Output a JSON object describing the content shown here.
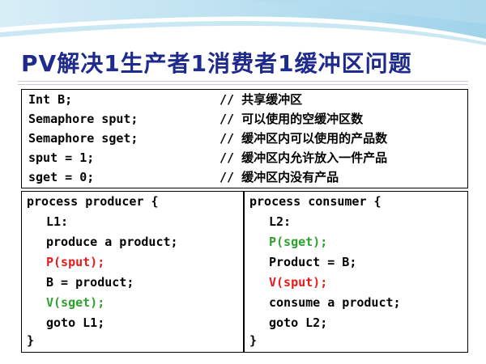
{
  "slide": {
    "title": "PV解决1生产者1消费者1缓冲区问题",
    "colors": {
      "title": "#1e2a8c",
      "red": "#e8191a",
      "green": "#2ea02e",
      "swoosh": "#bfe3f2"
    }
  },
  "declarations": [
    {
      "code": "Int B;",
      "comment": "// 共享缓冲区"
    },
    {
      "code": "Semaphore sput;",
      "comment": "// 可以使用的空缓冲区数"
    },
    {
      "code": "Semaphore sget;",
      "comment": "// 缓冲区内可以使用的产品数"
    },
    {
      "code": "sput = 1;",
      "comment": "// 缓冲区内允许放入一件产品"
    },
    {
      "code": "sget = 0;",
      "comment": "// 缓冲区内没有产品"
    }
  ],
  "producer": [
    "process producer {",
    "L1:",
    "produce a product;",
    "P(sput);",
    "B = product;",
    "V(sget);",
    "goto L1;",
    "}"
  ],
  "consumer": [
    "process consumer {",
    "L2:",
    "P(sget);",
    "Product = B;",
    "V(sput);",
    "consume a product;",
    "goto L2;",
    "}"
  ]
}
